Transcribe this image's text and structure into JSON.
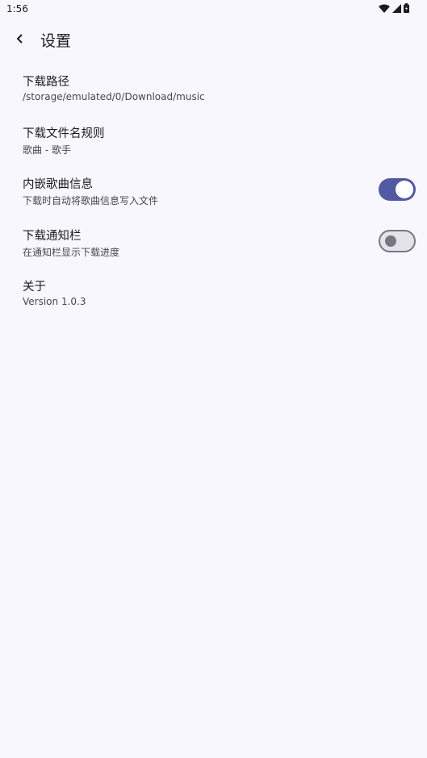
{
  "status_bar": {
    "time": "1:56",
    "icons": [
      "wifi-icon",
      "cellular-signal-icon",
      "battery-icon"
    ]
  },
  "app_bar": {
    "back_icon": "chevron-left-icon",
    "title": "设置"
  },
  "settings": [
    {
      "title": "下载路径",
      "subtitle": "/storage/emulated/0/Download/music"
    },
    {
      "title": "下载文件名规则",
      "subtitle": "歌曲 - 歌手"
    },
    {
      "title": "内嵌歌曲信息",
      "subtitle": "下载时自动将歌曲信息写入文件",
      "toggle": true
    },
    {
      "title": "下载通知栏",
      "subtitle": "在通知栏显示下载进度",
      "toggle": false
    },
    {
      "title": "关于",
      "subtitle": "Version 1.0.3"
    }
  ],
  "colors": {
    "background": "#f8f7fd",
    "accent": "#525aa3",
    "text_primary": "#1c1b1f",
    "text_secondary": "#49454f"
  }
}
